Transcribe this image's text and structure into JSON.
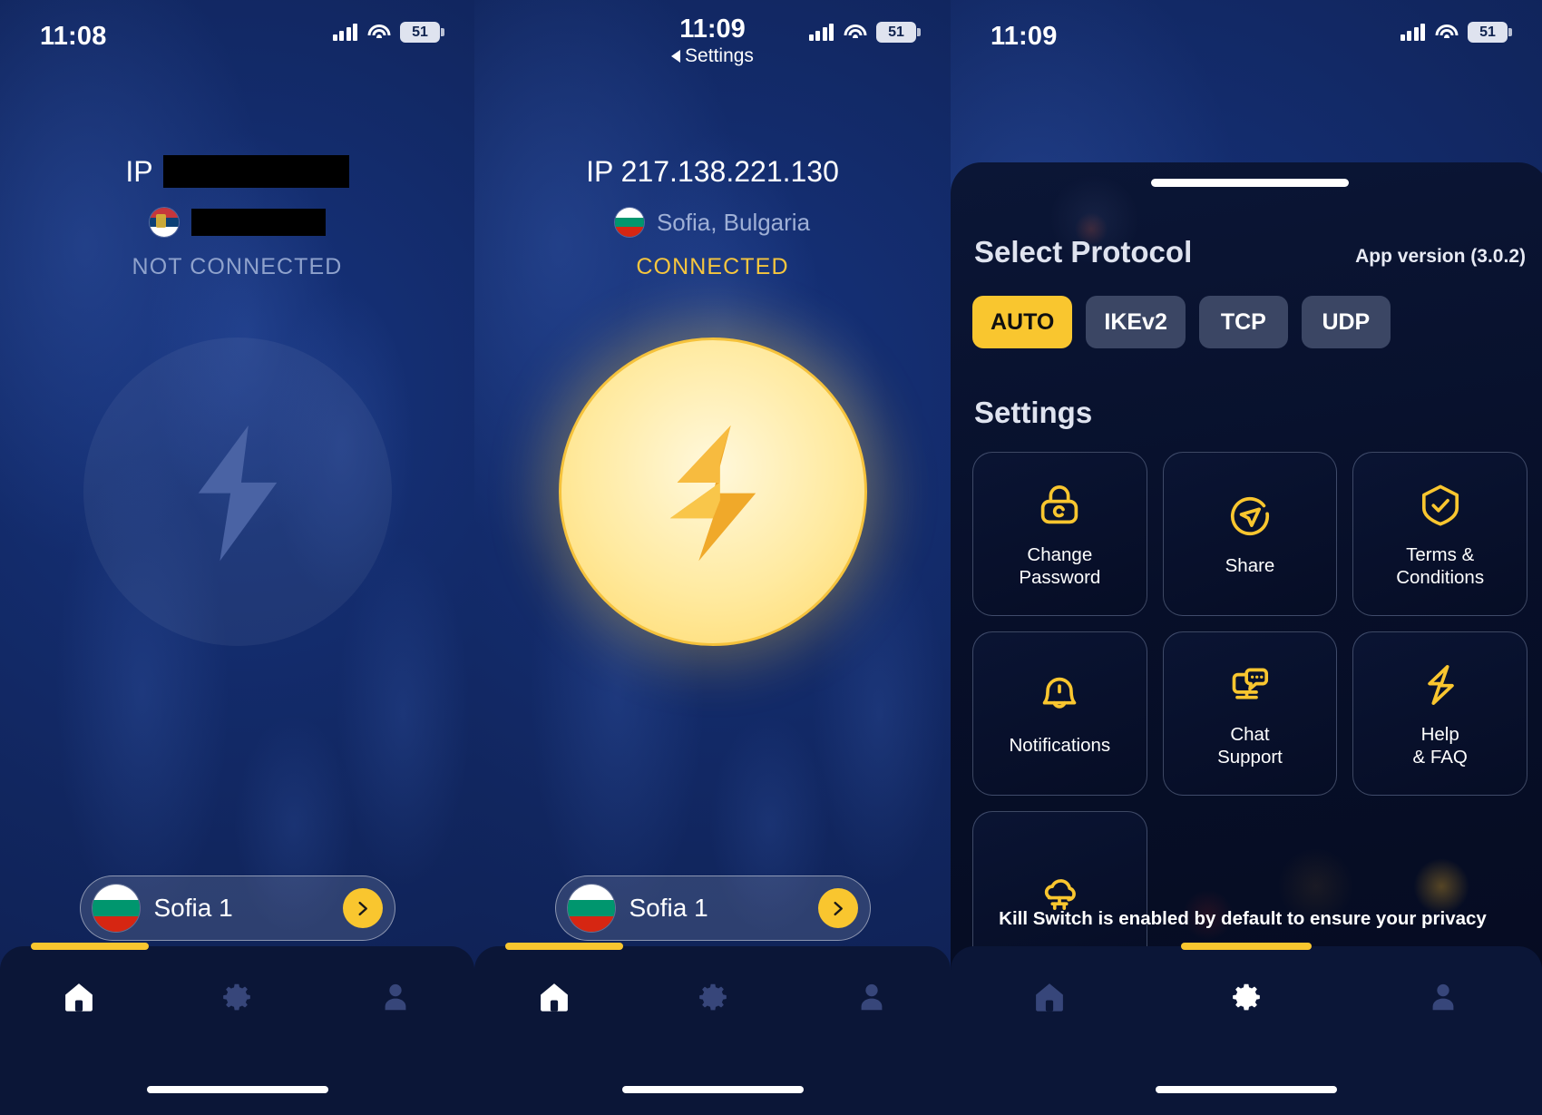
{
  "panels": [
    {
      "id": "home-disconnected",
      "statusbar": {
        "time": "11:08",
        "battery": "51",
        "signal_icon": "cellular-bars-icon",
        "wifi_icon": "wifi-icon",
        "battery_icon": "battery-icon"
      },
      "ip_label": "IP",
      "ip_value": "",
      "ip_redacted": true,
      "location": "",
      "location_redacted": true,
      "flag": "serbia-flag",
      "connection_status": "NOT CONNECTED",
      "connected": false,
      "power_button_label": "power-toggle",
      "server": {
        "name": "Sofia 1",
        "flag": "bulgaria-flag",
        "chevron": "chevron-right-icon"
      },
      "tabs": [
        {
          "name": "home",
          "icon": "home-icon",
          "active": true
        },
        {
          "name": "settings",
          "icon": "gear-icon",
          "active": false
        },
        {
          "name": "account",
          "icon": "person-icon",
          "active": false
        }
      ]
    },
    {
      "id": "home-connected",
      "statusbar": {
        "time": "11:09",
        "battery": "51",
        "back_label": "Settings",
        "signal_icon": "cellular-bars-icon",
        "wifi_icon": "wifi-icon",
        "battery_icon": "battery-icon"
      },
      "ip_label": "IP",
      "ip_value": "IP 217.138.221.130",
      "ip_redacted": false,
      "location": "Sofia, Bulgaria",
      "location_redacted": false,
      "flag": "bulgaria-flag",
      "connection_status": "CONNECTED",
      "connected": true,
      "power_button_label": "power-toggle",
      "server": {
        "name": "Sofia 1",
        "flag": "bulgaria-flag",
        "chevron": "chevron-right-icon"
      },
      "tabs": [
        {
          "name": "home",
          "icon": "home-icon",
          "active": true
        },
        {
          "name": "settings",
          "icon": "gear-icon",
          "active": false
        },
        {
          "name": "account",
          "icon": "person-icon",
          "active": false
        }
      ]
    },
    {
      "id": "settings-sheet",
      "statusbar": {
        "time": "11:09",
        "battery": "51",
        "signal_icon": "cellular-bars-icon",
        "wifi_icon": "wifi-icon",
        "battery_icon": "battery-icon"
      },
      "tabs": [
        {
          "name": "home",
          "icon": "home-icon",
          "active": false
        },
        {
          "name": "settings",
          "icon": "gear-icon",
          "active": true
        },
        {
          "name": "account",
          "icon": "person-icon",
          "active": false
        }
      ]
    }
  ],
  "settings_sheet": {
    "grabber": "drag-handle",
    "title": "Select Protocol",
    "app_version": "App version (3.0.2)",
    "protocols": [
      {
        "label": "AUTO",
        "active": true
      },
      {
        "label": "IKEv2",
        "active": false
      },
      {
        "label": "TCP",
        "active": false
      },
      {
        "label": "UDP",
        "active": false
      }
    ],
    "section_title": "Settings",
    "items": [
      {
        "label": "Change\nPassword",
        "line1": "Change",
        "line2": "Password",
        "icon": "lock-icon"
      },
      {
        "label": "Share",
        "line1": "Share",
        "line2": "",
        "icon": "send-circle-icon"
      },
      {
        "label": "Terms & Conditions",
        "line1": "Terms &",
        "line2": "Conditions",
        "icon": "shield-check-icon"
      },
      {
        "label": "Notifications",
        "line1": "Notifications",
        "line2": "",
        "icon": "bell-icon"
      },
      {
        "label": "Chat Support",
        "line1": "Chat",
        "line2": "Support",
        "icon": "chat-support-icon"
      },
      {
        "label": "Help & FAQ",
        "line1": "Help",
        "line2": "& FAQ",
        "icon": "lightning-bolt-icon"
      },
      {
        "label": "",
        "line1": "",
        "line2": "",
        "icon": "cloud-network-icon"
      }
    ],
    "kill_switch_note": "Kill Switch is enabled by default to ensure your privacy"
  },
  "colors": {
    "accent": "#f9c62f",
    "background": "#112a6b",
    "sheet_bg": "#070f29",
    "connected_text": "#f7c63e",
    "disconnected_text": "#8fa2cc"
  }
}
